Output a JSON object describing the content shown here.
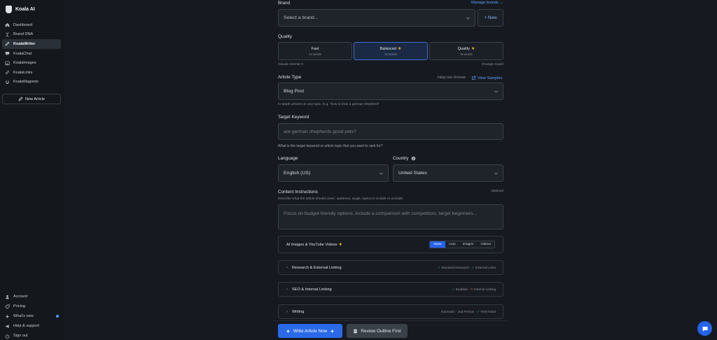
{
  "app": {
    "name": "Koala AI"
  },
  "sidebar": {
    "items": [
      {
        "label": "Dashboard",
        "icon": "home-icon"
      },
      {
        "label": "Brand DNA",
        "icon": "dna-icon"
      },
      {
        "label": "KoalaWriter",
        "icon": "pencil-icon",
        "active": true
      },
      {
        "label": "KoalaChat",
        "icon": "chat-icon"
      },
      {
        "label": "KoalaImages",
        "icon": "image-icon"
      },
      {
        "label": "KoalaLinks",
        "icon": "link-icon"
      },
      {
        "label": "KoalaMagnets",
        "icon": "magnet-icon"
      }
    ],
    "new_article": "New Article",
    "bottom": [
      {
        "label": "Account",
        "icon": "user-icon"
      },
      {
        "label": "Pricing",
        "icon": "tag-icon"
      },
      {
        "label": "What's new",
        "icon": "sparkle-icon"
      },
      {
        "label": "Help & support",
        "icon": "megaphone-icon"
      },
      {
        "label": "Sign out",
        "icon": "power-icon"
      }
    ]
  },
  "form": {
    "brand": {
      "label": "Brand",
      "manage_link": "Manage brands →",
      "placeholder": "Select a brand...",
      "new_button": "+ New"
    },
    "quality": {
      "label": "Quality",
      "options": [
        {
          "name": "Fast",
          "sub": "1x words"
        },
        {
          "name": "Balanced",
          "sub": "2x words",
          "selected": true,
          "star": "★"
        },
        {
          "name": "Quality",
          "sub": "3x words",
          "star": "★"
        }
      ],
      "model": "Claude Sonnet 3",
      "change_model": "Change model"
    },
    "article_type": {
      "label": "Article Type",
      "help_link": "Help me choose",
      "view_samples": "View Samples",
      "value": "Blog Post",
      "hint": "In-depth articles on any topic. E.g. \"how to train a german shepherd\""
    },
    "keyword": {
      "label": "Target Keyword",
      "placeholder": "are german shepherds good pets?",
      "hint": "What is the target keyword or article topic that you want to rank for?"
    },
    "language": {
      "label": "Language",
      "value": "English (US)"
    },
    "country": {
      "label": "Country",
      "value": "United States"
    },
    "instructions": {
      "label": "Content Instructions",
      "optional": "Optional",
      "hint": "Describe what the article should cover: audience, angle, topics to include or exclude.",
      "placeholder": "Focus on budget-friendly options, include a comparison with competitors, target beginners..."
    },
    "media": {
      "label": "AI Images & YouTube Videos",
      "star": "★",
      "options": [
        "None",
        "Auto",
        "Images",
        "Videos"
      ],
      "selected": "None"
    },
    "sections": [
      {
        "label": "Research & External Linking",
        "tag1": "✓",
        "tag1_text": "Standard Research",
        "sep": "·",
        "tag2": "✓",
        "tag2_text": "External Links"
      },
      {
        "label": "SEO & Internal Linking",
        "tag1": "✓",
        "tag1_text": "Enabled",
        "sep": "·",
        "tag2": "✕",
        "tag2_text": "Internal Linking"
      },
      {
        "label": "Writing",
        "summary": "Automatic · 2nd Person ·",
        "tag2": "✓",
        "tag2_text": "First-Hand"
      }
    ],
    "arrow": "›"
  },
  "actions": {
    "write": "Write Article Now",
    "outline": "Review Outline First"
  },
  "colors": {
    "accent": "#2563eb",
    "background": "#161a20",
    "star": "#f5c02e",
    "check": "#44c26b"
  }
}
